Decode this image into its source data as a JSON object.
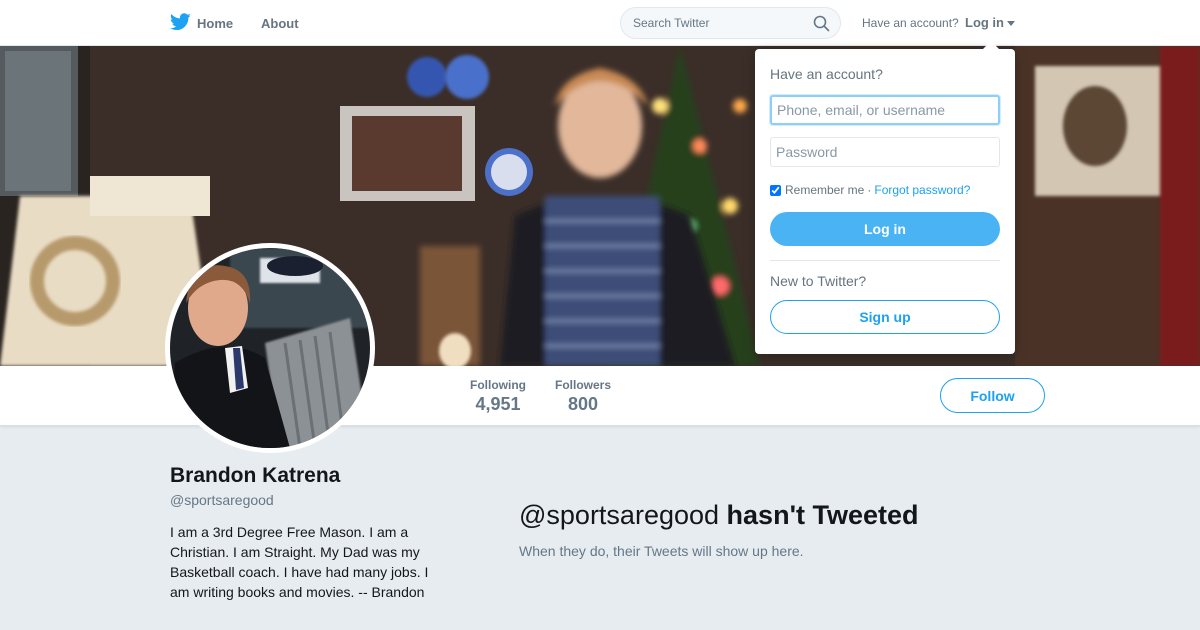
{
  "nav": {
    "home_label": "Home",
    "about_label": "About",
    "search_placeholder": "Search Twitter",
    "have_account_text": "Have an account?",
    "login_toggle_label": "Log in",
    "brand_color": "#1da1f2"
  },
  "profile": {
    "name": "Brandon Katrena",
    "handle": "@sportsaregood",
    "bio": "I am a 3rd Degree Free Mason. I am a Christian. I am Straight. My Dad was my Basketball coach. I have had many jobs. I am writing books and movies. -- Brandon",
    "following_label": "Following",
    "following_count": "4,951",
    "followers_label": "Followers",
    "followers_count": "800",
    "follow_button_label": "Follow"
  },
  "timeline": {
    "empty_handle": "@sportsaregood",
    "empty_title_suffix": "hasn't Tweeted",
    "empty_subtitle": "When they do, their Tweets will show up here."
  },
  "login_dropdown": {
    "title": "Have an account?",
    "username_placeholder": "Phone, email, or username",
    "password_placeholder": "Password",
    "remember_label": "Remember me",
    "separator": "·",
    "forgot_label": "Forgot password?",
    "login_button_label": "Log in",
    "new_to_twitter": "New to Twitter?",
    "signup_button_label": "Sign up",
    "remember_checked": true
  },
  "icons": {
    "logo": "twitter-bird-icon",
    "search": "search-icon",
    "caret": "caret-down-icon"
  }
}
